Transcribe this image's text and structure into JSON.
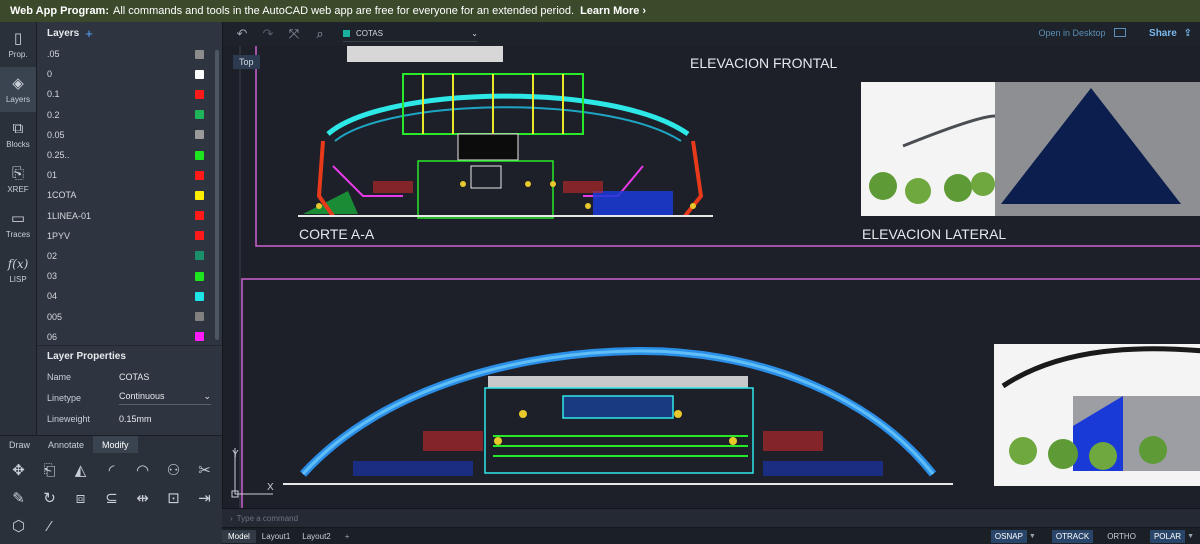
{
  "banner": {
    "title": "Web App Program:",
    "text": "All commands and tools in the AutoCAD web app are free for everyone for an extended period.",
    "link": "Learn More ›"
  },
  "rail": [
    {
      "label": "Prop.",
      "icon": "document-icon",
      "glyph": "▯"
    },
    {
      "label": "Layers",
      "icon": "layers-icon",
      "glyph": "◈"
    },
    {
      "label": "Blocks",
      "icon": "blocks-icon",
      "glyph": "⧉"
    },
    {
      "label": "XREF",
      "icon": "xref-icon",
      "glyph": "⎘"
    },
    {
      "label": "Traces",
      "icon": "traces-icon",
      "glyph": "▭"
    },
    {
      "label": "LISP",
      "icon": "function-icon",
      "glyph": "f(x)"
    }
  ],
  "layers": {
    "title": "Layers",
    "add": "+",
    "items": [
      {
        "name": ".05",
        "color": "#8c8c8c"
      },
      {
        "name": "0",
        "color": "#ffffff"
      },
      {
        "name": "0.1",
        "color": "#ff1a1a"
      },
      {
        "name": "0.2",
        "color": "#1fb35a"
      },
      {
        "name": "0.05",
        "color": "#9a9a9a"
      },
      {
        "name": "0.25..",
        "color": "#1ee61e"
      },
      {
        "name": "01",
        "color": "#ff1a1a"
      },
      {
        "name": "1COTA",
        "color": "#ffee00"
      },
      {
        "name": "1LINEA-01",
        "color": "#ff1a1a"
      },
      {
        "name": "1PYV",
        "color": "#ff1a1a"
      },
      {
        "name": "02",
        "color": "#1a8f6a"
      },
      {
        "name": "03",
        "color": "#1ee61e"
      },
      {
        "name": "04",
        "color": "#1ee6e6"
      },
      {
        "name": "005",
        "color": "#808080"
      },
      {
        "name": "06",
        "color": "#ff1aff"
      }
    ]
  },
  "properties": {
    "title": "Layer Properties",
    "rows": [
      {
        "key": "Name",
        "value": "COTAS"
      },
      {
        "key": "Linetype",
        "value": "Continuous"
      },
      {
        "key": "Lineweight",
        "value": "0.15mm"
      }
    ]
  },
  "tools": {
    "tabs": [
      "Draw",
      "Annotate",
      "Modify"
    ],
    "active": "Modify",
    "icons": [
      {
        "name": "move-icon",
        "glyph": "✥"
      },
      {
        "name": "copy-icon",
        "glyph": "⎗"
      },
      {
        "name": "mirror-icon",
        "glyph": "◭"
      },
      {
        "name": "fillet-icon",
        "glyph": "◜"
      },
      {
        "name": "chamfer-icon",
        "glyph": "◠"
      },
      {
        "name": "array-icon",
        "glyph": "⚇"
      },
      {
        "name": "trim-icon",
        "glyph": "✂"
      },
      {
        "name": "erase-icon",
        "glyph": "✎"
      },
      {
        "name": "rotate-icon",
        "glyph": "↻"
      },
      {
        "name": "scale-icon",
        "glyph": "⧈"
      },
      {
        "name": "offset-icon",
        "glyph": "⊆"
      },
      {
        "name": "join-icon",
        "glyph": "⇹"
      },
      {
        "name": "match-properties-icon",
        "glyph": "⊡"
      },
      {
        "name": "extend-icon",
        "glyph": "⇥"
      },
      {
        "name": "3d-box-icon",
        "glyph": "⬡"
      },
      {
        "name": "line-icon",
        "glyph": "⁄"
      }
    ]
  },
  "toolbar": {
    "current_layer": "COTAS",
    "open_desktop": "Open in Desktop",
    "share": "Share"
  },
  "drawing": {
    "view": "Top",
    "labels": {
      "frontal": "ELEVACION FRONTAL",
      "lateral": "ELEVACION LATERAL",
      "corte": "CORTE A-A"
    },
    "axis_x": "X",
    "axis_y": "Y"
  },
  "command": {
    "placeholder": "Type a command"
  },
  "status": {
    "tabs": [
      "Model",
      "Layout1",
      "Layout2"
    ],
    "add": "+",
    "toggles": [
      {
        "label": "OSNAP",
        "on": true
      },
      {
        "label": "OTRACK",
        "on": true
      },
      {
        "label": "ORTHO",
        "on": false
      },
      {
        "label": "POLAR",
        "on": true
      }
    ]
  }
}
